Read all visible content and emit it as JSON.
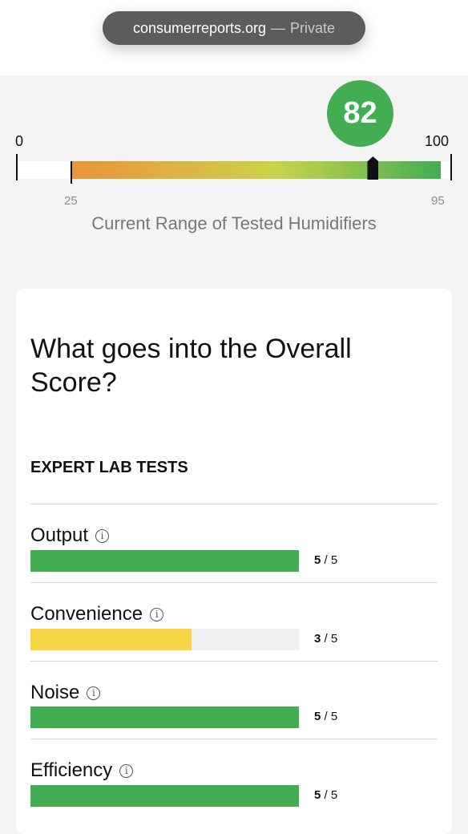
{
  "browser": {
    "domain": "consumerreports.org",
    "separator": "—",
    "mode": "Private"
  },
  "score": {
    "value": 82,
    "axis_min": "0",
    "axis_max": "100",
    "range_low": "25",
    "range_high": "95",
    "caption": "Current Range of Tested Humidifiers",
    "colors": {
      "badge": "#43ad52",
      "range_start": "#e8953a",
      "range_end": "#43ad52"
    }
  },
  "overall": {
    "title": "What goes into the Overall Score?",
    "section": "EXPERT LAB TESTS",
    "metrics": [
      {
        "label": "Output",
        "score": "5",
        "max": "/ 5",
        "value": 5,
        "color": "#43ad52"
      },
      {
        "label": "Convenience",
        "score": "3",
        "max": "/ 5",
        "value": 3,
        "color": "#f7d443"
      },
      {
        "label": "Noise",
        "score": "5",
        "max": "/ 5",
        "value": 5,
        "color": "#43ad52"
      },
      {
        "label": "Efficiency",
        "score": "5",
        "max": "/ 5",
        "value": 5,
        "color": "#43ad52"
      }
    ],
    "info_icon": "info-circle-icon"
  }
}
